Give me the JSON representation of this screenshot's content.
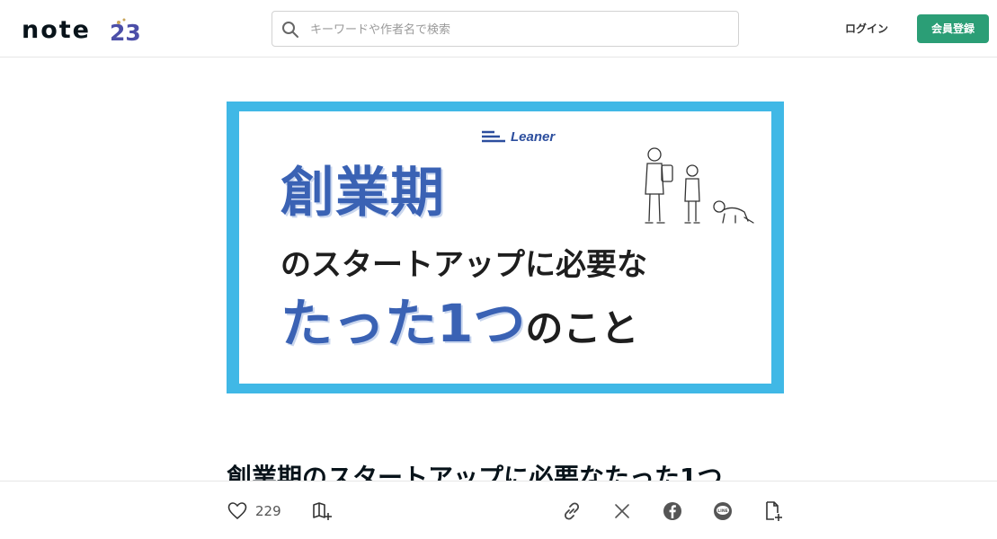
{
  "header": {
    "logo_text": "note",
    "logo_badge": "23",
    "search": {
      "placeholder": "キーワードや作者名で検索",
      "value": ""
    },
    "login_label": "ログイン",
    "signup_label": "会員登録",
    "signup_color": "#2b9e76"
  },
  "hero": {
    "brand": "Leaner",
    "line1": "創業期",
    "line2": "のスタートアップに必要な",
    "line3_emph": "たった1つ",
    "line3_rest": "のこと",
    "frame_color": "#40b8e6",
    "accent_color": "#3a62b4"
  },
  "article": {
    "title": "創業期のスタートアップに必要なたった1つ"
  },
  "actionbar": {
    "like_count": "229",
    "icons": [
      "heart-icon",
      "magazine-add-icon",
      "link-icon",
      "x-icon",
      "facebook-icon",
      "line-icon",
      "note-add-icon"
    ]
  }
}
